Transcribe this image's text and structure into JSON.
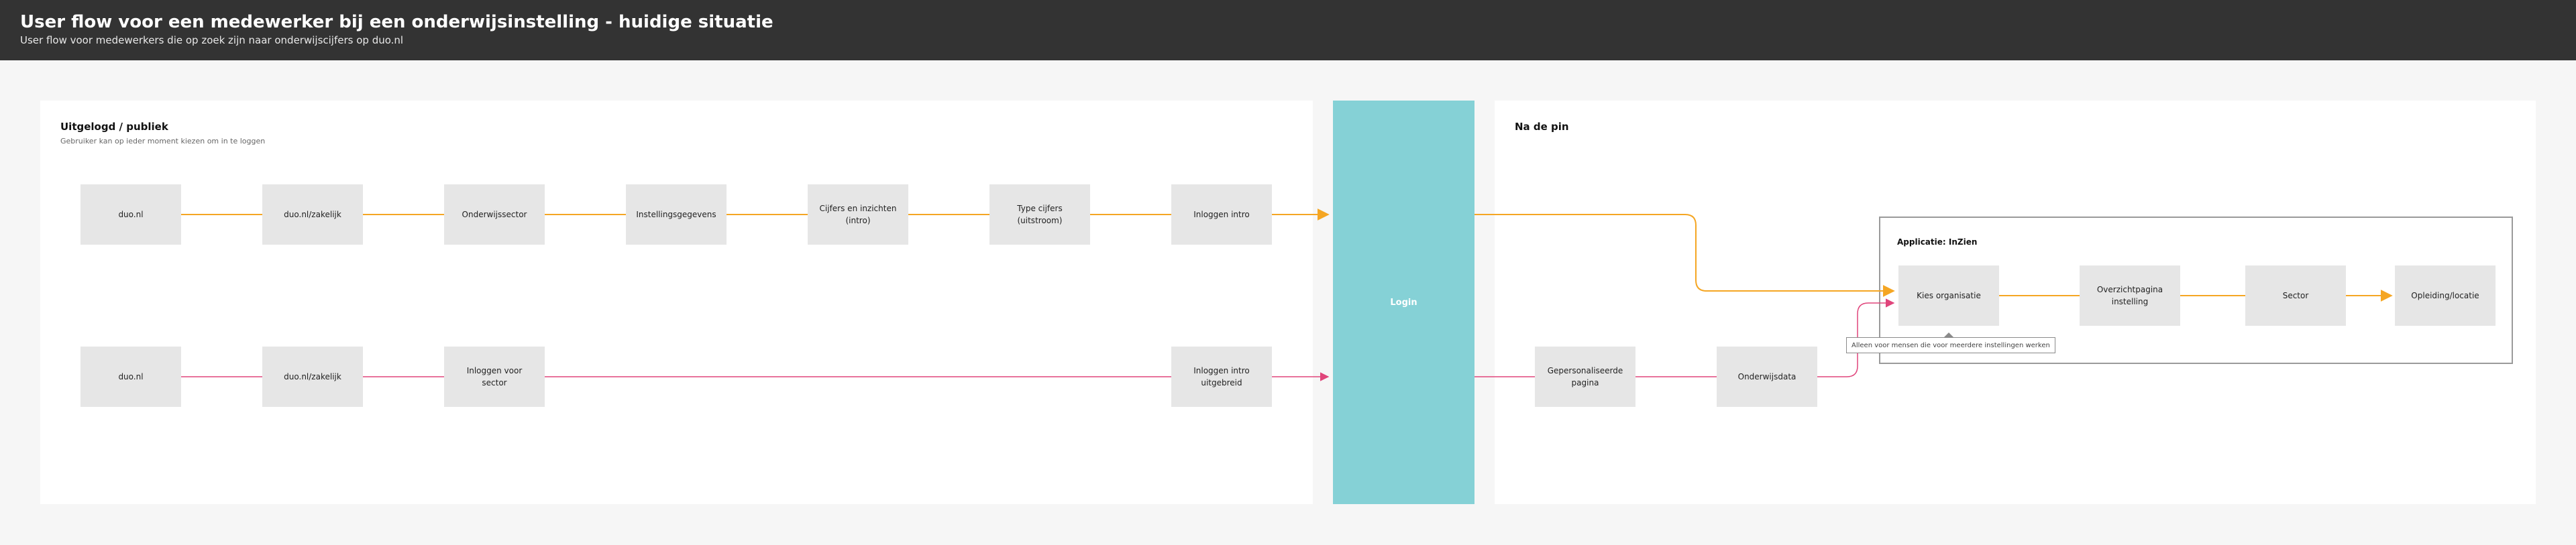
{
  "header": {
    "title": "User flow voor een medewerker bij een onderwijsinstelling - huidige situatie",
    "subtitle": "User flow voor medewerkers die op zoek zijn naar onderwijscijfers op duo.nl"
  },
  "left_panel": {
    "title": "Uitgelogd / publiek",
    "subtitle": "Gebruiker kan op ieder moment kiezen om in te loggen"
  },
  "right_panel": {
    "title": "Na de pin"
  },
  "login": {
    "label": "Login"
  },
  "app": {
    "label": "Applicatie: InZien",
    "tooltip": "Alleen voor mensen die voor meerdere instellingen werken"
  },
  "flows": {
    "public_row1": [
      "duo.nl",
      "duo.nl/zakelijk",
      "Onderwijssector",
      "Instellingsgegevens",
      "Cijfers en inzichten (intro)",
      "Type cijfers (uitstroom)",
      "Inloggen intro"
    ],
    "public_row2": [
      "duo.nl",
      "duo.nl/zakelijk",
      "Inloggen voor sector",
      "Inloggen intro uitgebreid"
    ],
    "after_pin": [
      "Gepersonaliseerde pagina",
      "Onderwijsdata"
    ],
    "app_row": [
      "Kies organisatie",
      "Overzichtpagina instelling",
      "Sector",
      "Opleiding/locatie"
    ]
  },
  "colors": {
    "header_bg": "#333333",
    "login_bg": "#85d1d6",
    "flow_yellow": "#f5a623",
    "flow_pink": "#e0457b",
    "node_bg": "#e6e6e6"
  }
}
